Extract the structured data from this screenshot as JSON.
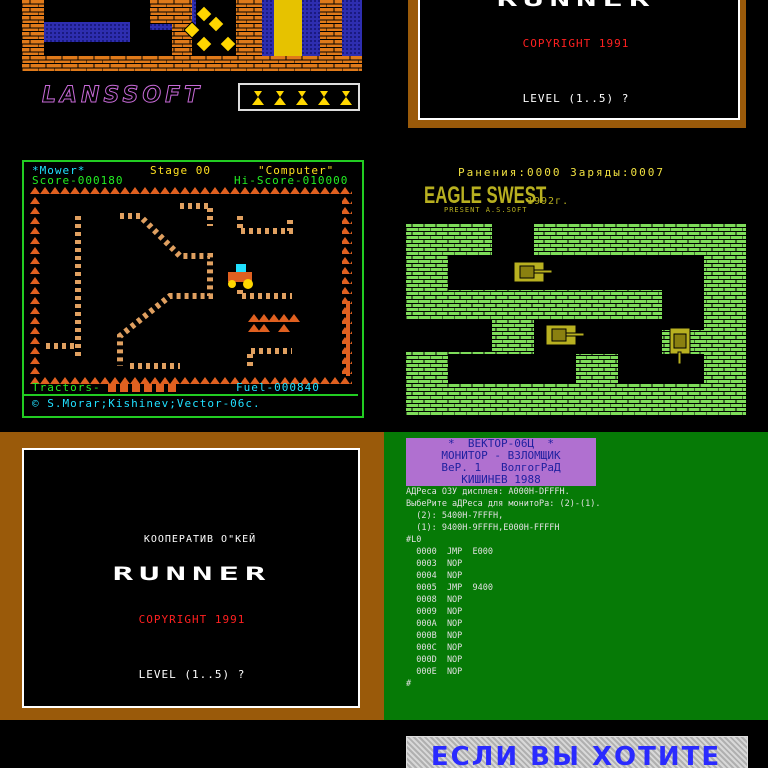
{
  "lanssoft": {
    "logo_text": "LANSSOFT",
    "colors": {
      "brick": "#e07a1a",
      "wall": "#2e2eb0",
      "gold": "#ffd700",
      "logo": "#c86ad8"
    }
  },
  "runner_top": {
    "title": "RUNNER",
    "copyright": "COPYRIGHT 1991",
    "level_prompt": "LEVEL (1..5) ?"
  },
  "mower": {
    "title": "*Mower*",
    "stage": "Stage 00",
    "mode": "\"Computer\"",
    "score": "Score-000180",
    "hiscore": "Hi-Score-010000",
    "tractors_label": "Tractors-",
    "fuel": "Fuel-000840",
    "credit": "© S.Morar;Kishinev;Vector-06c.",
    "colors": {
      "frame": "#22cc22",
      "text_green": "#22ee22",
      "text_yellow": "#ffe020",
      "cyan": "#20e0ff",
      "hedge": "#e06020",
      "bead": "#e0a060"
    }
  },
  "eagle": {
    "status": "Ранения:0000  Заряды:0007",
    "title": "EAGLE SWEST",
    "year": "1992г.",
    "present": "PRESENT A.S.SOFT",
    "colors": {
      "brick": "#7edc5a",
      "tank": "#b8b020",
      "text": "#f0e040"
    }
  },
  "runner": {
    "coop": "КООПЕРАТИВ О\"КЕЙ",
    "title": "RUNNER",
    "copyright": "COPYRIGHT 1991",
    "level_prompt": "LEVEL (1..5) ?",
    "colors": {
      "frame": "#9a5a0a",
      "copyright": "#ff2020"
    }
  },
  "monitor": {
    "header": [
      "*  ВЕКТОР-06Ц  *",
      "МОНИТОР - ВЗЛОМЩИК",
      "ВеР. 1   ВолгогРаД",
      "КИШИНЕВ 1988"
    ],
    "lines": [
      "АДРеса ОЗУ дисплея: А000Н-DFFFH.",
      "ВыбеРите аДРеса для монитоРа: (2)-(1).",
      "  (2): 5400Н-7FFFH,",
      "  (1): 9400Н-9FFFH,E000H-FFFFH",
      "#L0",
      "  0000  JMP  E000",
      "  0003  NOP",
      "  0004  NOP",
      "  0005  JMP  9400",
      "  0008  NOP",
      "  0009  NOP",
      "  000A  NOP",
      "  000B  NOP",
      "  000C  NOP",
      "  000D  NOP",
      "  000E  NOP",
      "#"
    ],
    "colors": {
      "bg": "#067a06",
      "header_bg": "#b070d0",
      "header_text": "#2020a0",
      "text": "#e0e0e0"
    }
  },
  "bottom_right": {
    "text": "ЕСЛИ ВЫ ХОТИТЕ",
    "colors": {
      "text": "#2a2aff",
      "bg": "#c0c0c0"
    }
  }
}
